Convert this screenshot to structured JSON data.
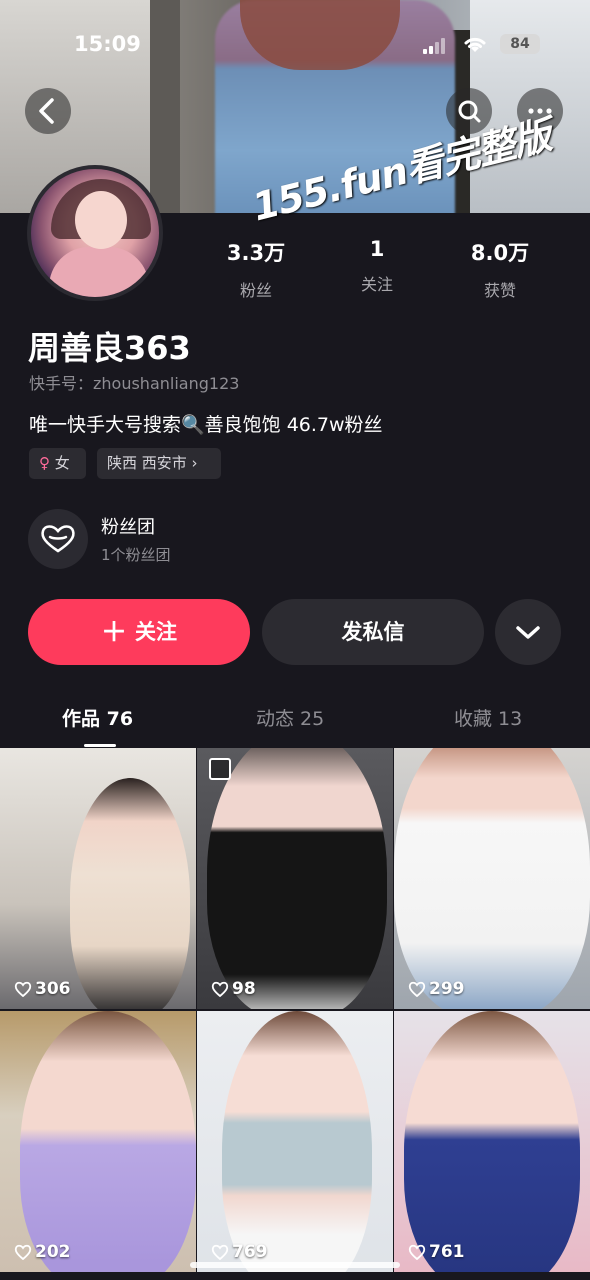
{
  "status_bar": {
    "time": "15:09",
    "battery": "84"
  },
  "header": {
    "back_icon": "chevron-left-icon",
    "search_icon": "search-icon",
    "more_icon": "more-dots-icon"
  },
  "watermark": "155.fun看完整版",
  "profile": {
    "name": "周善良363",
    "kuaishou_id": "快手号：zhoushanliang123",
    "bio": "唯一快手大号搜索🔍善良饱饱 46.7w粉丝",
    "stats": [
      {
        "value": "3.3万",
        "label": "粉丝"
      },
      {
        "value": "1",
        "label": "关注"
      },
      {
        "value": "8.0万",
        "label": "获赞"
      }
    ],
    "tags": {
      "gender": "女",
      "location": "陕西 西安市 ›"
    },
    "fan_group": {
      "title": "粉丝团",
      "subtitle": "1个粉丝团"
    }
  },
  "actions": {
    "follow": "关注",
    "message": "发私信"
  },
  "tabs": [
    {
      "label": "作品 76",
      "active": true
    },
    {
      "label": "动态 25",
      "active": false
    },
    {
      "label": "收藏 13",
      "active": false
    }
  ],
  "videos": [
    {
      "likes": "306"
    },
    {
      "likes": "98"
    },
    {
      "likes": "299"
    },
    {
      "likes": "202"
    },
    {
      "likes": "769"
    },
    {
      "likes": "761"
    }
  ],
  "colors": {
    "accent": "#fe3b5c",
    "background": "#18171e",
    "surface": "#2c2b31"
  }
}
